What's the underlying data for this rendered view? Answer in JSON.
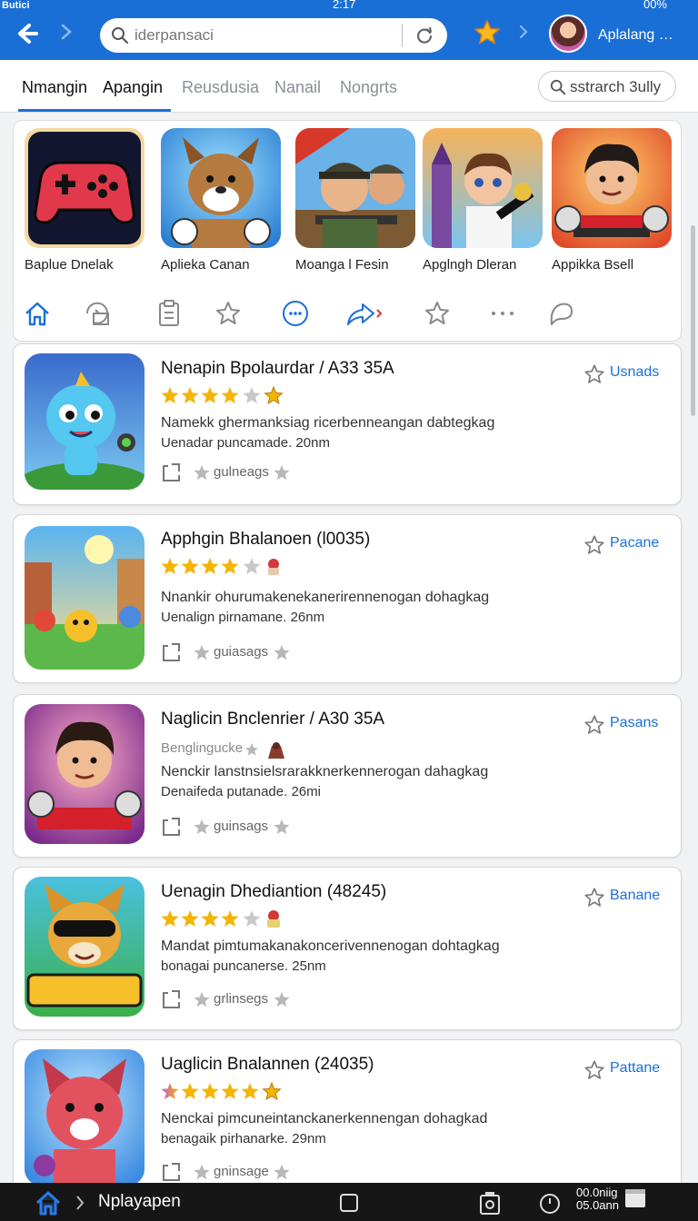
{
  "status": {
    "carrier": "Butici",
    "time": "2:17",
    "battery": "00%"
  },
  "header": {
    "search_placeholder": "iderpansaci",
    "user_name": "Aplalang …"
  },
  "tabs": [
    {
      "label": "Nmangin"
    },
    {
      "label": "Apangin"
    },
    {
      "label": "Reusdusia"
    },
    {
      "label": "Nanail"
    },
    {
      "label": "Nongrts"
    }
  ],
  "tab_search_label": "sstrarch 3ully",
  "featured": [
    {
      "label": "Baplue Dnelak"
    },
    {
      "label": "Aplieka Canan"
    },
    {
      "label": "Moanga l Fesin"
    },
    {
      "label": "Apglngh Dleran"
    },
    {
      "label": "Appikka Bsell"
    }
  ],
  "apps": [
    {
      "title": "Nenapin Bpolaurdar / A33 35A",
      "rating": 3.5,
      "sub_label": "",
      "desc1": "Namekk ghermanksiag ricerbenneangan dabtegkag",
      "desc2": "Uenadar puncamade. 20nm",
      "meta": "gulneags",
      "action": "Usnads"
    },
    {
      "title": "Apphgin Bhalanoen (l0035)",
      "rating": 3.5,
      "sub_label": "",
      "desc1": "Nnankir ohurumakenekanerirennenogan dohagkag",
      "desc2": "Uenalign pirnamane. 26nm",
      "meta": "guiasags",
      "action": "Pacane"
    },
    {
      "title": "Naglicin Bnclenrier / A30 35A",
      "rating": null,
      "sub_label": "Benglingucke",
      "desc1": "Nenckir lanstnsielsrarakknerkennerogan dahagkag",
      "desc2": "Denaifeda putanade. 26mi",
      "meta": "guinsags",
      "action": "Pasans"
    },
    {
      "title": "Uenagin Dhediantion (48245)",
      "rating": 3.5,
      "sub_label": "",
      "desc1": "Mandat pimtumakanakoncerivennenogan dohtagkag",
      "desc2": "bonagai puncanerse. 25nm",
      "meta": "grlinsegs",
      "action": "Banane"
    },
    {
      "title": "Uaglicin Bnalannen (24035)",
      "rating": 5,
      "sub_label": "",
      "desc1": "Nenckai pimcuneintanckanerkennengan dohagkad",
      "desc2": "benagaik pirhanarke. 29nm",
      "meta": "gninsage",
      "action": "Pattane"
    }
  ],
  "bottom": {
    "label": "Nplayapen",
    "time_line1": "00.0niig",
    "time_line2": "05.0ann"
  },
  "colors": {
    "accent": "#1a6fd6",
    "star": "#f5b400"
  }
}
